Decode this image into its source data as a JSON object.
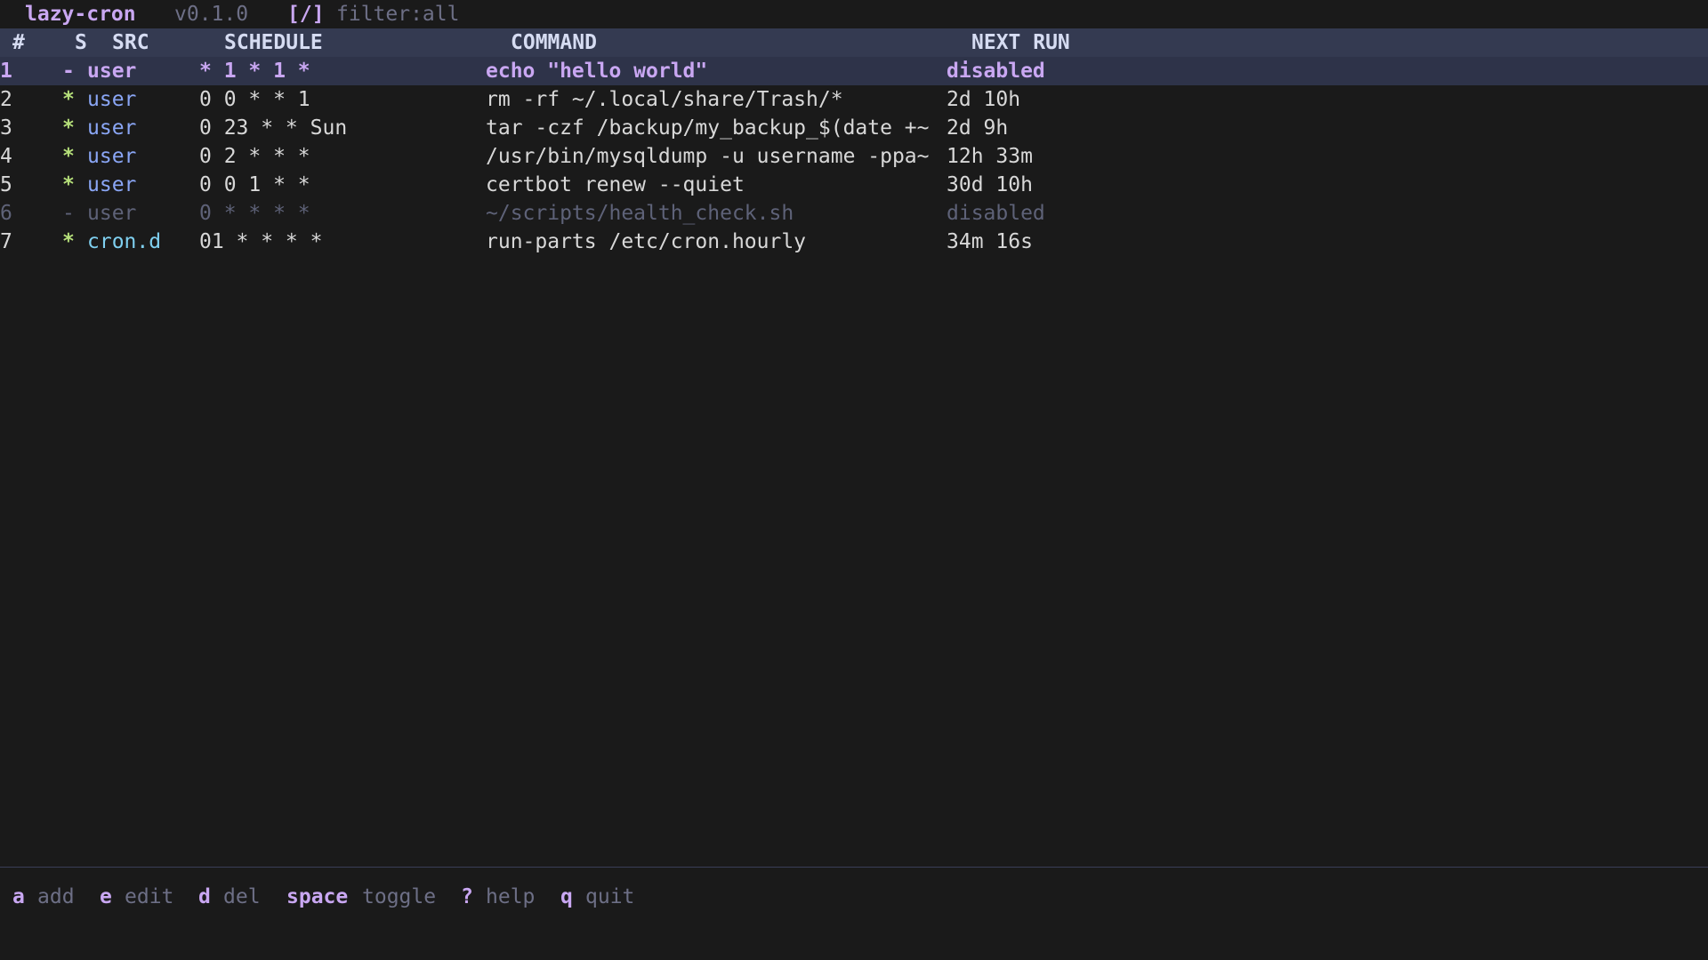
{
  "titlebar": {
    "app_name": "lazy-cron",
    "version": "v0.1.0",
    "filter_key": "[/]",
    "filter_value": "filter:all"
  },
  "columns": {
    "num": "#",
    "state": "S",
    "src": "SRC",
    "schedule": "SCHEDULE",
    "command": "COMMAND",
    "next_run": "NEXT RUN"
  },
  "rows": [
    {
      "num": "1",
      "state": "-",
      "src": "user",
      "schedule": "* 1 * 1 *",
      "command": "echo \"hello world\"",
      "next_run": "disabled"
    },
    {
      "num": "2",
      "state": "*",
      "src": "user",
      "schedule": "0 0 * * 1",
      "command": "rm -rf ~/.local/share/Trash/*",
      "next_run": "2d 10h"
    },
    {
      "num": "3",
      "state": "*",
      "src": "user",
      "schedule": "0 23 * * Sun",
      "command": "tar -czf /backup/my_backup_$(date +~",
      "next_run": "2d 9h"
    },
    {
      "num": "4",
      "state": "*",
      "src": "user",
      "schedule": "0 2 * * *",
      "command": "/usr/bin/mysqldump -u username -ppa~",
      "next_run": "12h 33m"
    },
    {
      "num": "5",
      "state": "*",
      "src": "user",
      "schedule": "0 0 1 * *",
      "command": "certbot renew --quiet",
      "next_run": "30d 10h"
    },
    {
      "num": "6",
      "state": "-",
      "src": "user",
      "schedule": "0 * * * *",
      "command": "~/scripts/health_check.sh",
      "next_run": "disabled"
    },
    {
      "num": "7",
      "state": "*",
      "src": "cron.d",
      "schedule": "01 * * * *",
      "command": "run-parts /etc/cron.hourly",
      "next_run": "34m 16s"
    }
  ],
  "footer": [
    {
      "key": "a",
      "desc": "add"
    },
    {
      "key": "e",
      "desc": "edit"
    },
    {
      "key": "d",
      "desc": "del"
    },
    {
      "key": "space",
      "desc": "toggle"
    },
    {
      "key": "?",
      "desc": "help"
    },
    {
      "key": "q",
      "desc": "quit"
    }
  ],
  "colors": {
    "background": "#1a1a1a",
    "accent": "#c9a7f2",
    "header_bg": "#343a51",
    "selected_bg": "#2e3349",
    "enabled_marker": "#b6e07a",
    "src_user": "#8aa6f5",
    "src_crond": "#7fd0f0",
    "muted": "#6d6f86"
  }
}
